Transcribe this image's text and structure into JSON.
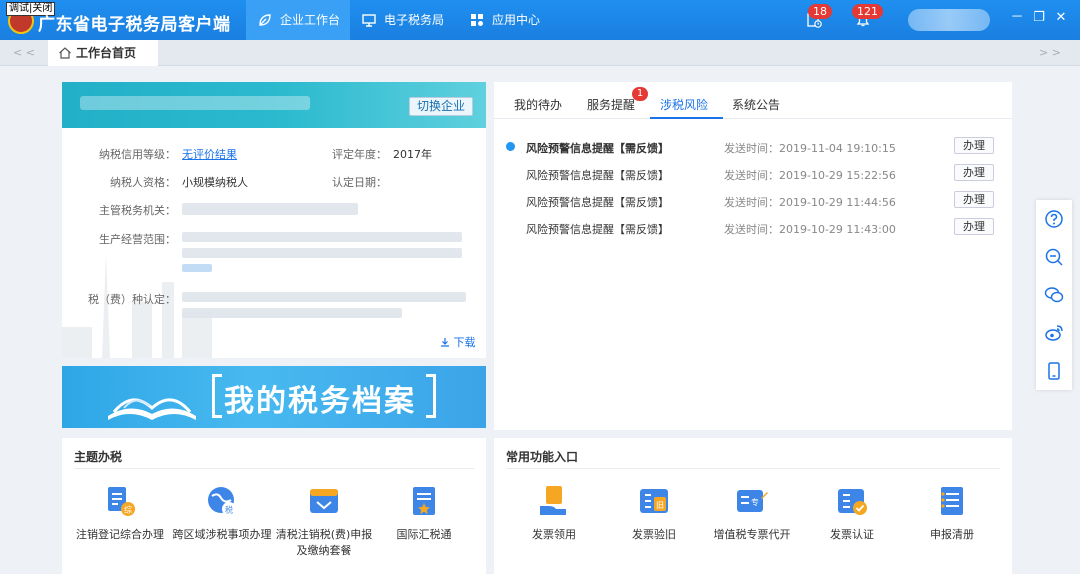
{
  "titlebar": {
    "debug_label": "调试|关闭",
    "title": "广东省电子税务局客户端",
    "tabs": [
      {
        "label": "企业工作台",
        "active": true
      },
      {
        "label": "电子税务局",
        "active": false
      },
      {
        "label": "应用中心",
        "active": false
      }
    ],
    "task_badge": "18",
    "bell_badge": "121",
    "win_min": "－",
    "win_max": "❐",
    "win_close": "✕"
  },
  "tabstrip": {
    "left_arrow": "< <",
    "right_arrow": "> >",
    "home_tab": "工作台首页"
  },
  "taxpayer": {
    "switch_button": "切换企业",
    "credit_label": "纳税信用等级：",
    "credit_value": "无评价结果",
    "year_label": "评定年度：",
    "year_value": "2017年",
    "qualification_label": "纳税人资格：",
    "qualification_value": "小规模纳税人",
    "date_label": "认定日期：",
    "authority_label": "主管税务机关：",
    "scope_label": "生产经营范围：",
    "tax_type_label": "税（费）种认定：",
    "download": "下载"
  },
  "banner": {
    "text": "我的税务档案"
  },
  "messages": {
    "tabs": [
      {
        "label": "我的待办",
        "active": false
      },
      {
        "label": "服务提醒",
        "active": false,
        "badge": "1"
      },
      {
        "label": "涉税风险",
        "active": true
      },
      {
        "label": "系统公告",
        "active": false
      }
    ],
    "rows": [
      {
        "title": "风险预警信息提醒【需反馈】",
        "time": "发送时间：2019-11-04 19:10:15",
        "action": "办理",
        "unread": true
      },
      {
        "title": "风险预警信息提醒【需反馈】",
        "time": "发送时间：2019-10-29 15:22:56",
        "action": "办理",
        "unread": false
      },
      {
        "title": "风险预警信息提醒【需反馈】",
        "time": "发送时间：2019-10-29 11:44:56",
        "action": "办理",
        "unread": false
      },
      {
        "title": "风险预警信息提醒【需反馈】",
        "time": "发送时间：2019-10-29 11:43:00",
        "action": "办理",
        "unread": false
      }
    ]
  },
  "themes": {
    "title": "主题办税",
    "items": [
      {
        "label": "注销登记综合办理",
        "icon": "deregister-icon"
      },
      {
        "label": "跨区域涉税事项办理",
        "icon": "cross-region-icon"
      },
      {
        "label": "清税注销税(费)申报及缴纳套餐",
        "icon": "tax-clearance-icon"
      },
      {
        "label": "国际汇税通",
        "icon": "international-tax-icon"
      }
    ]
  },
  "common": {
    "title": "常用功能入口",
    "items": [
      {
        "label": "发票领用",
        "icon": "invoice-receive-icon"
      },
      {
        "label": "发票验旧",
        "icon": "invoice-verify-icon"
      },
      {
        "label": "增值税专票代开",
        "icon": "vat-invoice-icon"
      },
      {
        "label": "发票认证",
        "icon": "invoice-auth-icon"
      },
      {
        "label": "申报清册",
        "icon": "declaration-list-icon"
      }
    ]
  },
  "colors": {
    "primary": "#1a7fe0",
    "accent": "#1a73e8",
    "badge": "#e53935",
    "teal_header": "#22b0c8"
  }
}
